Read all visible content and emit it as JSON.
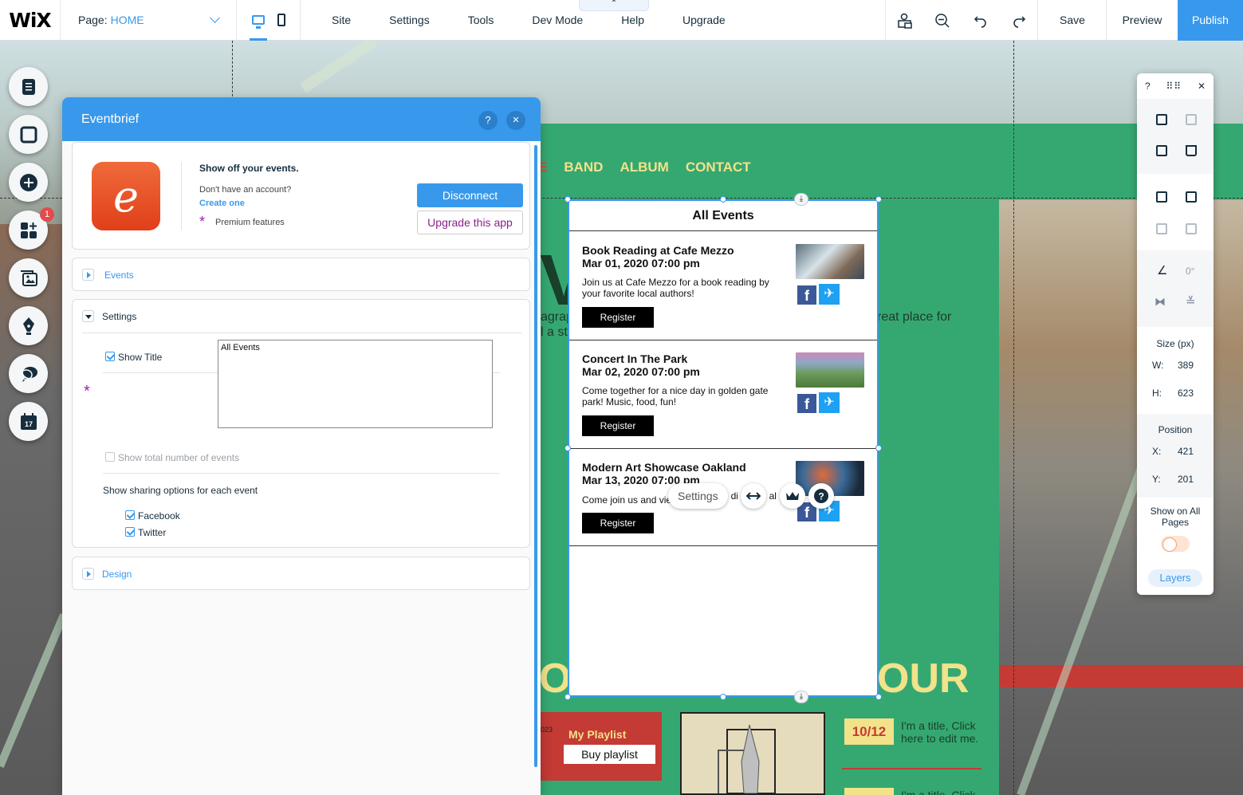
{
  "topbar": {
    "logo": "WiX",
    "page_label": "Page:",
    "page_value": "HOME",
    "menu": [
      "Site",
      "Settings",
      "Tools",
      "Dev Mode",
      "Help",
      "Upgrade"
    ],
    "collapse_glyph": "⌃",
    "save": "Save",
    "preview": "Preview",
    "publish": "Publish"
  },
  "rail": {
    "badge": "1"
  },
  "panel": {
    "title": "Eventbrief",
    "help": "?",
    "close": "✕",
    "headline": "Show off your events.",
    "no_account": "Don't have an account?",
    "create": "Create one",
    "premium": "Premium features",
    "disconnect": "Disconnect",
    "upgrade": "Upgrade this app",
    "events_label": "Events",
    "settings_label": "Settings",
    "show_title": "Show Title",
    "title_value": "All Events",
    "show_total": "Show total number of events",
    "sharing_heading": "Show sharing options for each event",
    "facebook": "Facebook",
    "twitter": "Twitter",
    "design_label": "Design"
  },
  "site": {
    "nav_cut": "E",
    "nav": [
      "BAND",
      "ALBUM",
      "CONTACT"
    ],
    "big_ve": "VE",
    "para_left_1": "agrap",
    "para_left_2": "l a st",
    "para_right": "reat place for",
    "tour_left": "OU",
    "tour_right": "OUR",
    "playlist_title": "My Playlist",
    "playlist_button": "Buy playlist",
    "date_1": "10/12",
    "tour_item_1": "I'm a title, Click here to edit me.",
    "tour_item_2": "I'm a title. Click",
    "stamp": "023"
  },
  "widget": {
    "title": "All Events",
    "events": [
      {
        "name": "Book Reading at Cafe Mezzo",
        "date": "Mar 01, 2020 07:00 pm",
        "desc": "Join us at Cafe Mezzo for a book reading by your favorite local authors!",
        "register": "Register"
      },
      {
        "name": "Concert In The Park",
        "date": "Mar 02, 2020 07:00 pm",
        "desc": "Come together for a nice day in golden gate park! Music, food, fun!",
        "register": "Register"
      },
      {
        "name": "Modern Art Showcase Oakland",
        "date": "Mar 13, 2020 07:00 pm",
        "desc": "Come join us and vie",
        "register": "Register"
      }
    ]
  },
  "floatbar": {
    "settings": "Settings",
    "text_fragment": "al"
  },
  "rpanel": {
    "help": "?",
    "close": "✕",
    "rotation": "0°",
    "size_label": "Size (px)",
    "w_label": "W:",
    "w_value": "389",
    "h_label": "H:",
    "h_value": "623",
    "position_label": "Position",
    "x_label": "X:",
    "x_value": "421",
    "y_label": "Y:",
    "y_value": "201",
    "show_all": "Show on All Pages",
    "layers": "Layers"
  },
  "colors": {
    "accent": "#3899ec",
    "site_green": "#35a872",
    "site_yellow": "#f2e28a",
    "site_red": "#c43a35",
    "premium": "#a21caf"
  }
}
